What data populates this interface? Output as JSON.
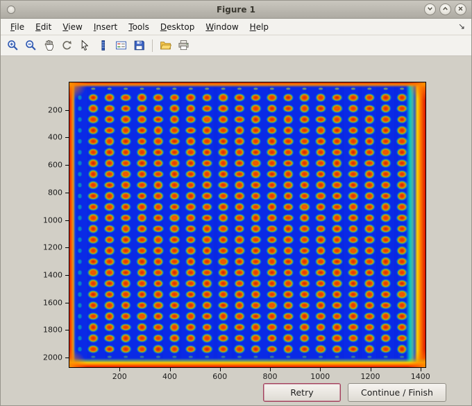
{
  "window": {
    "title": "Figure 1",
    "controls": {
      "minimize": "chevron-down",
      "maximize": "chevron-up",
      "close": "x"
    }
  },
  "menubar": {
    "items": [
      "File",
      "Edit",
      "View",
      "Insert",
      "Tools",
      "Desktop",
      "Window",
      "Help"
    ],
    "overflow_glyph": "↘"
  },
  "toolbar": {
    "icons": [
      "zoom-in",
      "zoom-out",
      "pan",
      "rotate-3d",
      "data-cursor",
      "colorbar",
      "insert-legend",
      "save",
      "open-folder",
      "print"
    ],
    "separator_before": "open-folder"
  },
  "figure": {
    "retry_label": "Retry",
    "continue_label": "Continue / Finish"
  },
  "chart_data": {
    "type": "heatmap",
    "title": "",
    "xlabel": "",
    "ylabel": "",
    "x_ticks": [
      200,
      400,
      600,
      800,
      1000,
      1200,
      1400
    ],
    "y_ticks": [
      200,
      400,
      600,
      800,
      1000,
      1200,
      1400,
      1600,
      1800,
      2000
    ],
    "xlim": [
      0,
      1420
    ],
    "ylim": [
      0,
      2070
    ],
    "description": "Microarray/plate scan rendered in jet colormap: 24 rows x 20 columns of red-orange spots with yellow-green halos on a saturated blue field; image borders saturate to red/orange, bright cyan-green vertical band just inside the right red edge",
    "grid": {
      "rows": 24,
      "cols": 20,
      "x_first": 95,
      "x_spacing": 64.8,
      "y_first": 110,
      "y_spacing": 79.5
    },
    "colors": {
      "background": "#0a2ae6",
      "spot_core": "#c81e00",
      "spot_mid": "#f05200",
      "spot_ring_yellow": "#d8a800",
      "spot_ring_green": "#50b446",
      "edge_red": "#e01800",
      "edge_orange": "#ff8c00",
      "edge_yellow": "#ffd800",
      "right_band_cyan": "#00e6be"
    }
  }
}
